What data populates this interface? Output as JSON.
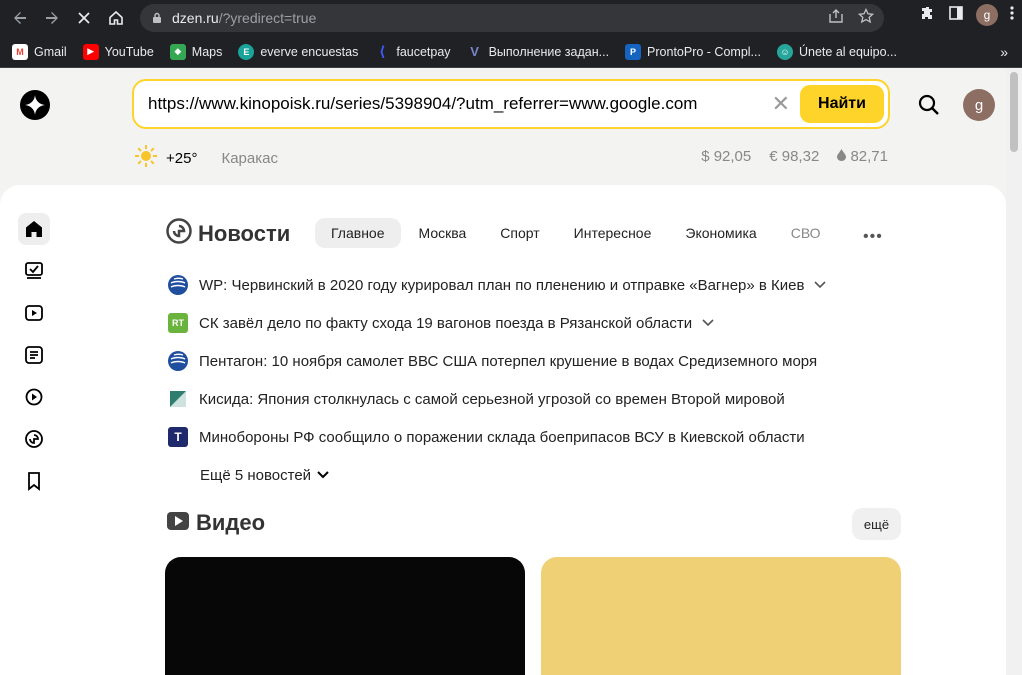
{
  "browser": {
    "url_host": "dzen.ru",
    "url_path": "/?yredirect=true",
    "profile_initial": "g"
  },
  "bookmarks": [
    {
      "label": "Gmail",
      "icon": "gmail-icon",
      "color": "#ea4335"
    },
    {
      "label": "YouTube",
      "icon": "youtube-icon",
      "color": "#ff0000"
    },
    {
      "label": "Maps",
      "icon": "maps-icon",
      "color": "#34a853"
    },
    {
      "label": "everve encuestas",
      "icon": "everve-icon",
      "color": "#1aa39a"
    },
    {
      "label": "faucetpay",
      "icon": "faucetpay-icon",
      "color": "#3d5afe"
    },
    {
      "label": "Выполнение задан...",
      "icon": "task-icon",
      "color": "#7986cb"
    },
    {
      "label": "ProntoPro - Compl...",
      "icon": "prontopro-icon",
      "color": "#1565c0"
    },
    {
      "label": "Únete al equipo...",
      "icon": "join-icon",
      "color": "#26a69a"
    }
  ],
  "bookmarks_more": "»",
  "search": {
    "value": "https://www.kinopoisk.ru/series/5398904/?utm_referrer=www.google.com",
    "button": "Найти"
  },
  "user": {
    "initial": "g"
  },
  "info": {
    "temperature": "+25°",
    "city": "Каракас",
    "usd": "$ 92,05",
    "eur": "€ 98,32",
    "oil": "82,71"
  },
  "news": {
    "title": "Новости",
    "tabs": [
      "Главное",
      "Москва",
      "Спорт",
      "Интересное",
      "Экономика",
      "СВО"
    ],
    "items": [
      {
        "text": "WP: Червинский в 2020 году курировал план по пленению и отправке «Вагнер» в Киев",
        "source_icon": "globe-icon",
        "expand": true
      },
      {
        "text": "СК завёл дело по факту схода 19 вагонов поезда в Рязанской области",
        "source_icon": "rt-icon",
        "source_label": "RT",
        "expand": true
      },
      {
        "text": "Пентагон: 10 ноября самолет ВВС США потерпел крушение в водах Средиземного моря",
        "source_icon": "globe-icon",
        "expand": false
      },
      {
        "text": "Кисида: Япония столкнулась с самой серьезной угрозой со времен Второй мировой",
        "source_icon": "flag-icon",
        "expand": false
      },
      {
        "text": "Минобороны РФ сообщило о поражении склада боеприпасов ВСУ в Киевской области",
        "source_icon": "t-icon",
        "source_label": "T",
        "expand": false
      }
    ],
    "more": "Ещё 5 новостей"
  },
  "video": {
    "title": "Видео",
    "more": "ещё"
  },
  "colors": {
    "accent_yellow": "#fed42b",
    "chrome_dark": "#202124"
  }
}
